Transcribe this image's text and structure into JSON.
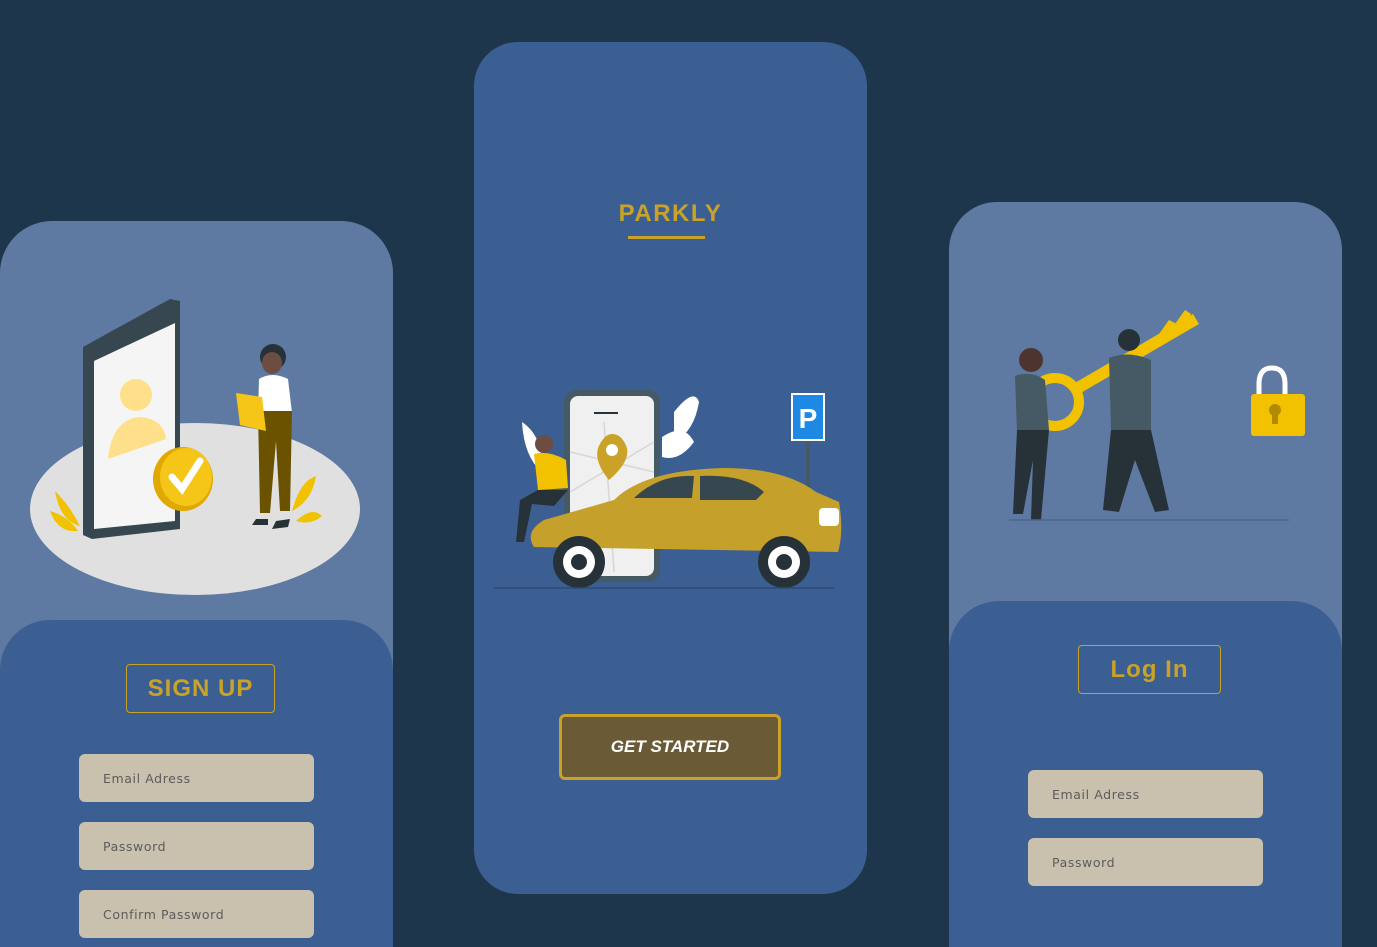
{
  "signup": {
    "title": "SIGN UP",
    "fields": [
      {
        "label": "Email Adress"
      },
      {
        "label": "Password"
      },
      {
        "label": "Confirm Password"
      }
    ]
  },
  "splash": {
    "brand": "PARKLY",
    "button_label": "GET STARTED",
    "parking_sign_letter": "P"
  },
  "login": {
    "title": "Log In",
    "fields": [
      {
        "label": "Email Adress"
      },
      {
        "label": "Password"
      }
    ]
  },
  "colors": {
    "background": "#1e364c",
    "card_primary": "#3c5f93",
    "card_secondary": "#5f7aa2",
    "accent_gold": "#c9a227",
    "button_fill": "#6b5a36",
    "field_fill": "#c9c0ae"
  },
  "icons": [
    "phone-profile-illustration",
    "checkmark-badge-icon",
    "map-pin-icon",
    "parking-sign-icon",
    "car-illustration",
    "key-illustration",
    "padlock-icon"
  ]
}
